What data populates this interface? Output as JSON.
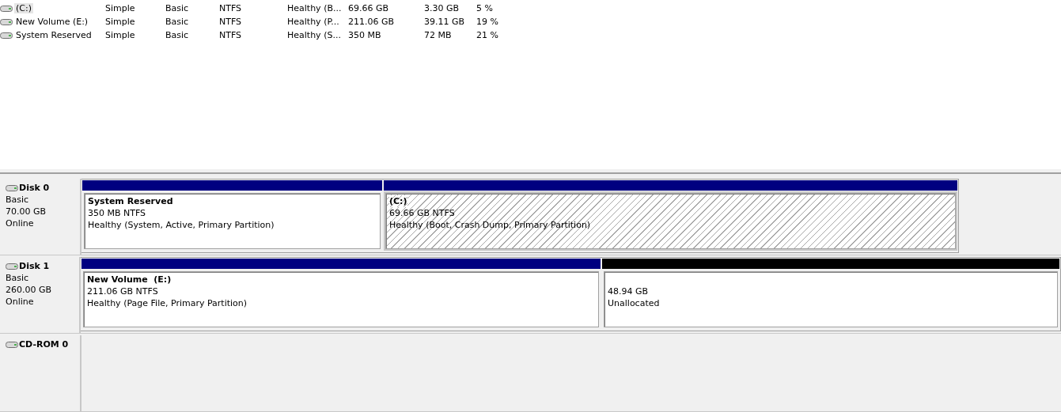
{
  "volumes": [
    {
      "name": "(C:)",
      "layout": "Simple",
      "type": "Basic",
      "file_system": "NTFS",
      "status": "Healthy (B...",
      "capacity": "69.66 GB",
      "free_space": "3.30 GB",
      "percent_free": "5 %",
      "selected": true
    },
    {
      "name": "New Volume (E:)",
      "layout": "Simple",
      "type": "Basic",
      "file_system": "NTFS",
      "status": "Healthy (P...",
      "capacity": "211.06 GB",
      "free_space": "39.11 GB",
      "percent_free": "19 %",
      "selected": false
    },
    {
      "name": "System Reserved",
      "layout": "Simple",
      "type": "Basic",
      "file_system": "NTFS",
      "status": "Healthy (S...",
      "capacity": "350 MB",
      "free_space": "72 MB",
      "percent_free": "21 %",
      "selected": false
    }
  ],
  "disks": [
    {
      "name": "Disk 0",
      "type": "Basic",
      "size": "70.00 GB",
      "status": "Online",
      "partitions": [
        {
          "kind": "primary",
          "name": "System Reserved",
          "size": "350 MB NTFS",
          "status": "Healthy (System, Active, Primary Partition)",
          "selected": false
        },
        {
          "kind": "primary",
          "name": "(C:)",
          "size": "69.66 GB NTFS",
          "status": "Healthy (Boot, Crash Dump, Primary Partition)",
          "selected": true
        }
      ]
    },
    {
      "name": "Disk 1",
      "type": "Basic",
      "size": "260.00 GB",
      "status": "Online",
      "partitions": [
        {
          "kind": "primary",
          "name": "New Volume  (E:)",
          "size": "211.06 GB NTFS",
          "status": "Healthy (Page File, Primary Partition)",
          "selected": false
        },
        {
          "kind": "unallocated",
          "size": "48.94 GB",
          "status": "Unallocated",
          "selected": false
        }
      ]
    },
    {
      "name": "CD-ROM 0"
    }
  ]
}
